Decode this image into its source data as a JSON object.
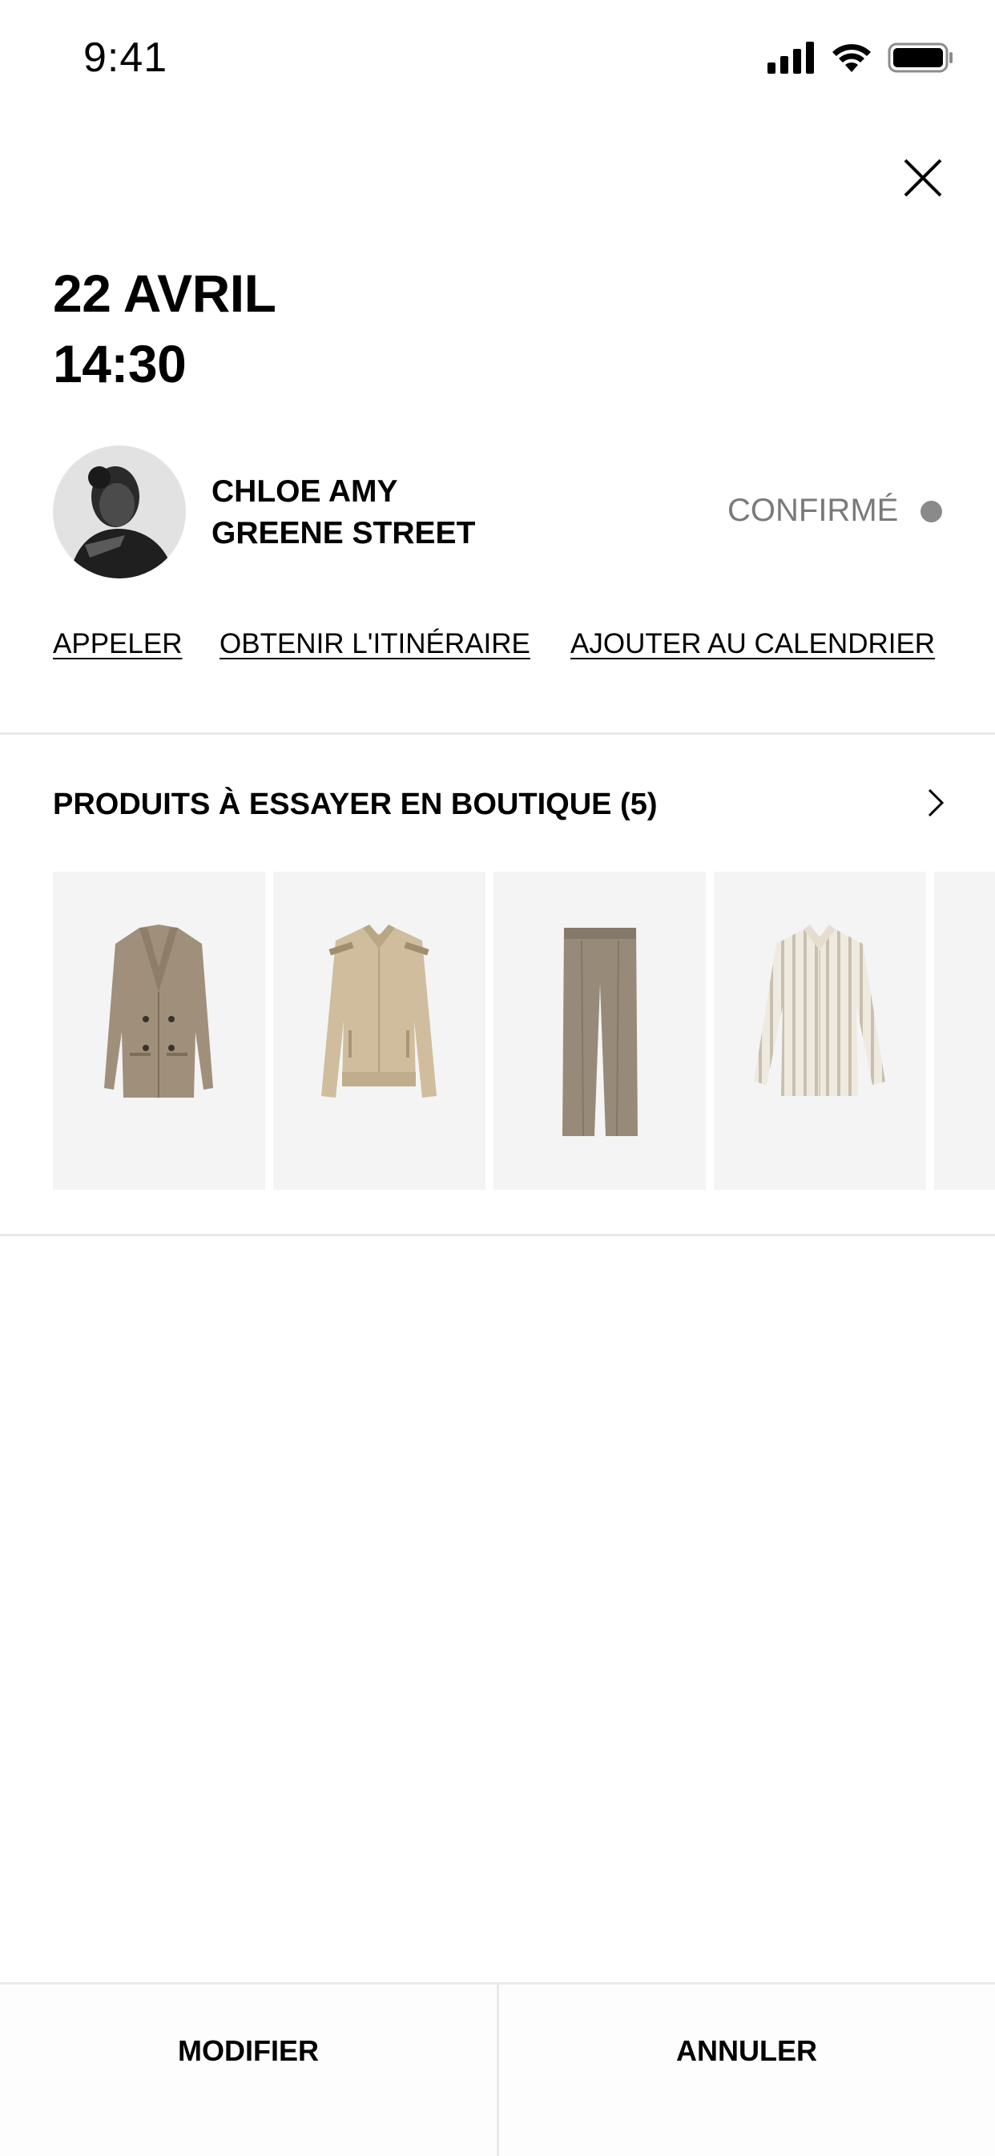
{
  "status_bar": {
    "time": "9:41",
    "icons": [
      "signal-icon",
      "wifi-icon",
      "battery-icon"
    ]
  },
  "appointment": {
    "date": "22 AVRIL",
    "time": "14:30"
  },
  "advisor": {
    "name": "CHLOE AMY",
    "store": "GREENE STREET",
    "status": "CONFIRMÉ",
    "status_color": "#8a8a8a"
  },
  "actions": {
    "call": "APPELER",
    "directions": "OBTENIR L'ITINÉRAIRE",
    "calendar": "AJOUTER AU CALENDRIER"
  },
  "products": {
    "title": "PRODUITS À ESSAYER EN BOUTIQUE (5)",
    "items": [
      {
        "kind": "double-breasted-blazer",
        "color": "#a08f7a"
      },
      {
        "kind": "bomber-jacket",
        "color": "#cfbd9d"
      },
      {
        "kind": "pleated-trousers",
        "color": "#978a79"
      },
      {
        "kind": "striped-shirt",
        "color": "#ece7dc"
      },
      {
        "kind": "partially-visible-item",
        "color": "#f4f4f5"
      }
    ]
  },
  "footer": {
    "modify": "MODIFIER",
    "cancel": "ANNULER"
  },
  "colors": {
    "background": "#ffffff",
    "divider": "#e9e9ec",
    "card_background": "#f4f4f5",
    "muted_text": "#7a7a7a"
  }
}
